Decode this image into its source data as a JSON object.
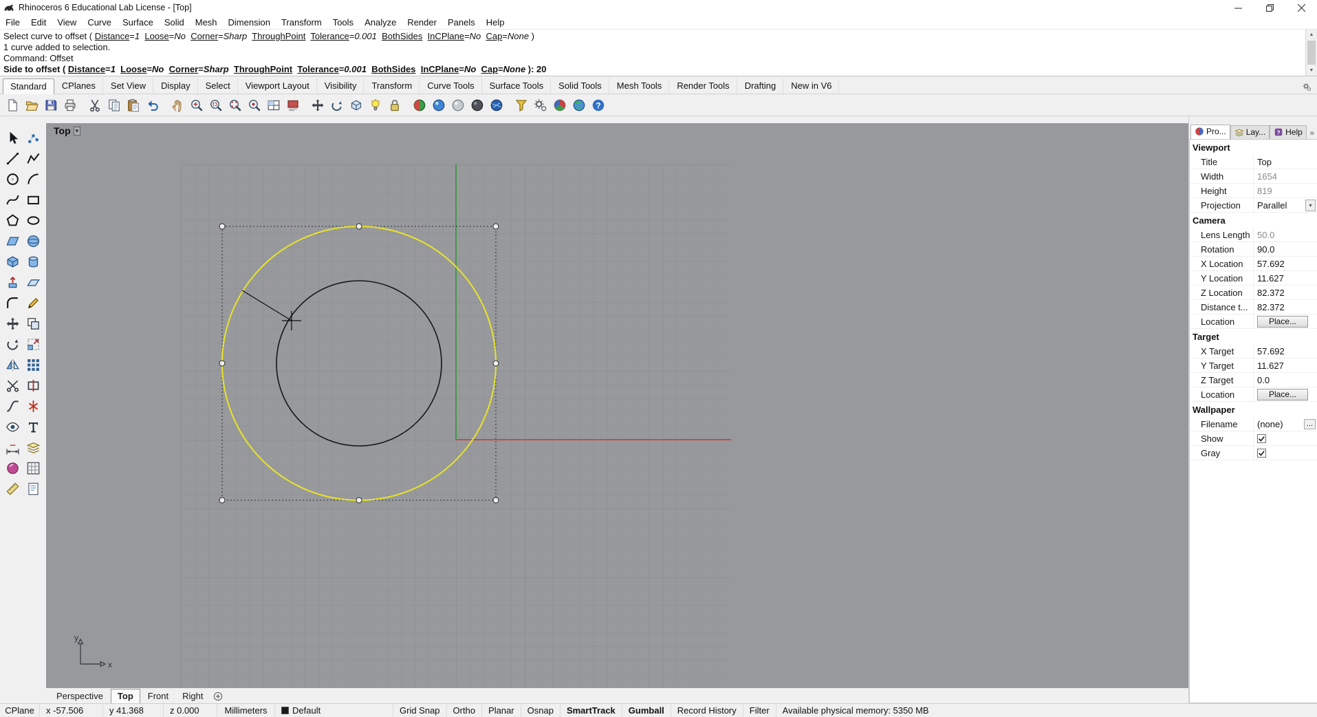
{
  "window": {
    "title": "Rhinoceros 6 Educational Lab License - [Top]"
  },
  "menubar": {
    "items": [
      "File",
      "Edit",
      "View",
      "Curve",
      "Surface",
      "Solid",
      "Mesh",
      "Dimension",
      "Transform",
      "Tools",
      "Analyze",
      "Render",
      "Panels",
      "Help"
    ]
  },
  "command_area": {
    "lines": [
      {
        "bold": false,
        "name": "command-history-line",
        "segments": [
          {
            "t": "Select curve to offset ( "
          },
          {
            "t": "Distance",
            "u": true
          },
          {
            "t": "="
          },
          {
            "t": "1",
            "i": true
          },
          {
            "t": "  "
          },
          {
            "t": "Loose",
            "u": true
          },
          {
            "t": "="
          },
          {
            "t": "No",
            "i": true
          },
          {
            "t": "  "
          },
          {
            "t": "Corner",
            "u": true
          },
          {
            "t": "="
          },
          {
            "t": "Sharp",
            "i": true
          },
          {
            "t": "  "
          },
          {
            "t": "ThroughPoint",
            "u": true
          },
          {
            "t": "  "
          },
          {
            "t": "Tolerance",
            "u": true
          },
          {
            "t": "="
          },
          {
            "t": "0.001",
            "i": true
          },
          {
            "t": "  "
          },
          {
            "t": "BothSides",
            "u": true
          },
          {
            "t": "  "
          },
          {
            "t": "InCPlane",
            "u": true
          },
          {
            "t": "="
          },
          {
            "t": "No",
            "i": true
          },
          {
            "t": "  "
          },
          {
            "t": "Cap",
            "u": true
          },
          {
            "t": "="
          },
          {
            "t": "None",
            "i": true
          },
          {
            "t": " )"
          }
        ]
      },
      {
        "bold": false,
        "name": "command-history-line",
        "segments": [
          {
            "t": "1 curve added to selection."
          }
        ]
      },
      {
        "bold": false,
        "name": "command-history-line",
        "segments": [
          {
            "t": "Command: Offset"
          }
        ]
      },
      {
        "bold": true,
        "name": "command-prompt-line",
        "segments": [
          {
            "t": "Side to offset ( "
          },
          {
            "t": "Distance",
            "u": true
          },
          {
            "t": "="
          },
          {
            "t": "1",
            "i": true
          },
          {
            "t": "  "
          },
          {
            "t": "Loose",
            "u": true
          },
          {
            "t": "="
          },
          {
            "t": "No",
            "i": true
          },
          {
            "t": "  "
          },
          {
            "t": "Corner",
            "u": true
          },
          {
            "t": "="
          },
          {
            "t": "Sharp",
            "i": true
          },
          {
            "t": "  "
          },
          {
            "t": "ThroughPoint",
            "u": true
          },
          {
            "t": "  "
          },
          {
            "t": "Tolerance",
            "u": true
          },
          {
            "t": "="
          },
          {
            "t": "0.001",
            "i": true
          },
          {
            "t": "  "
          },
          {
            "t": "BothSides",
            "u": true
          },
          {
            "t": "  "
          },
          {
            "t": "InCPlane",
            "u": true
          },
          {
            "t": "="
          },
          {
            "t": "No",
            "i": true
          },
          {
            "t": "  "
          },
          {
            "t": "Cap",
            "u": true
          },
          {
            "t": "="
          },
          {
            "t": "None",
            "i": true
          },
          {
            "t": " ): 20"
          }
        ]
      }
    ]
  },
  "toolbar_tabs": {
    "items": [
      {
        "label": "Standard",
        "active": true
      },
      {
        "label": "CPlanes"
      },
      {
        "label": "Set View"
      },
      {
        "label": "Display"
      },
      {
        "label": "Select"
      },
      {
        "label": "Viewport Layout"
      },
      {
        "label": "Visibility"
      },
      {
        "label": "Transform"
      },
      {
        "label": "Curve Tools"
      },
      {
        "label": "Surface Tools"
      },
      {
        "label": "Solid Tools"
      },
      {
        "label": "Mesh Tools"
      },
      {
        "label": "Render Tools"
      },
      {
        "label": "Drafting"
      },
      {
        "label": "New in V6"
      }
    ]
  },
  "toolbar": {
    "icons": [
      "new-file",
      "open-file",
      "save",
      "print",
      "cut",
      "copy",
      "paste",
      "undo",
      "pan",
      "zoom-dynamic",
      "zoom-window",
      "zoom-extents",
      "zoom-selected",
      "viewport-layout",
      "named-view",
      "move",
      "rotate-view",
      "set-view",
      "light",
      "lock",
      "shaded-mode",
      "rendered-mode",
      "ghosted-mode",
      "xray-mode",
      "raytraced-mode",
      "snap-filter",
      "options",
      "color-wheel",
      "earth",
      "help"
    ]
  },
  "sidebar": {
    "tools": [
      "select",
      "control-points",
      "line",
      "polyline",
      "circle",
      "arc",
      "curve",
      "rectangle",
      "polygon",
      "ellipse",
      "surface",
      "sphere",
      "box",
      "cylinder",
      "extrude",
      "plane",
      "fillet",
      "pencil",
      "move",
      "copy-tool",
      "rotate-tool",
      "scale-tool",
      "mirror-tool",
      "array-tool",
      "trim",
      "split",
      "join",
      "explode",
      "hide",
      "text",
      "dimension",
      "layer-tool",
      "material",
      "grid-tool",
      "measure",
      "notes"
    ]
  },
  "viewport": {
    "title": "Top",
    "axis_labels": {
      "x": "x",
      "y": "y"
    },
    "colors": {
      "background": "#97999d",
      "grid_minor": "#8e9094",
      "grid_major": "#85878b",
      "x_axis": "#bf4f47",
      "y_axis": "#3f9b46",
      "selected_curve": "#e9e426",
      "curve": "#17171a"
    },
    "tabs": [
      {
        "label": "Perspective"
      },
      {
        "label": "Top",
        "active": true
      },
      {
        "label": "Front"
      },
      {
        "label": "Right"
      }
    ]
  },
  "right_panel": {
    "tabs": [
      {
        "label": "Pro...",
        "icon": "properties-icon",
        "active": true
      },
      {
        "label": "Lay...",
        "icon": "layers-icon"
      },
      {
        "label": "Help",
        "icon": "help-icon"
      }
    ],
    "sections": [
      {
        "header": "Viewport",
        "rows": [
          {
            "label": "Title",
            "type": "text",
            "value": "Top"
          },
          {
            "label": "Width",
            "type": "readonly",
            "value": "1654"
          },
          {
            "label": "Height",
            "type": "readonly",
            "value": "819"
          },
          {
            "label": "Projection",
            "type": "dropdown",
            "value": "Parallel"
          }
        ]
      },
      {
        "header": "Camera",
        "rows": [
          {
            "label": "Lens Length",
            "type": "readonly",
            "value": "50.0"
          },
          {
            "label": "Rotation",
            "type": "text",
            "value": "90.0"
          },
          {
            "label": "X Location",
            "type": "text",
            "value": "57.692"
          },
          {
            "label": "Y Location",
            "type": "text",
            "value": "11.627"
          },
          {
            "label": "Z Location",
            "type": "text",
            "value": "82.372"
          },
          {
            "label": "Distance t...",
            "type": "text",
            "value": "82.372"
          },
          {
            "label": "Location",
            "type": "button",
            "value": "Place..."
          }
        ]
      },
      {
        "header": "Target",
        "rows": [
          {
            "label": "X Target",
            "type": "text",
            "value": "57.692"
          },
          {
            "label": "Y Target",
            "type": "text",
            "value": "11.627"
          },
          {
            "label": "Z Target",
            "type": "text",
            "value": "0.0"
          },
          {
            "label": "Location",
            "type": "button",
            "value": "Place..."
          }
        ]
      },
      {
        "header": "Wallpaper",
        "rows": [
          {
            "label": "Filename",
            "type": "filename",
            "value": "(none)",
            "button": "..."
          },
          {
            "label": "Show",
            "type": "checkbox",
            "checked": true
          },
          {
            "label": "Gray",
            "type": "checkbox",
            "checked": true
          }
        ]
      }
    ]
  },
  "statusbar": {
    "items": [
      {
        "label": "CPlane",
        "kind": "menu"
      },
      {
        "label": "x -57.506",
        "kind": "readout"
      },
      {
        "label": "y 41.368",
        "kind": "readout"
      },
      {
        "label": "z 0.000",
        "kind": "readout"
      },
      {
        "label": "Millimeters",
        "kind": "menu"
      },
      {
        "label": "Default",
        "kind": "menu",
        "swatch": "#1a1a1a"
      },
      {
        "label": "Grid Snap",
        "kind": "toggle"
      },
      {
        "label": "Ortho",
        "kind": "toggle"
      },
      {
        "label": "Planar",
        "kind": "toggle"
      },
      {
        "label": "Osnap",
        "kind": "toggle"
      },
      {
        "label": "SmartTrack",
        "kind": "toggle",
        "bold": true
      },
      {
        "label": "Gumball",
        "kind": "toggle",
        "bold": true
      },
      {
        "label": "Record History",
        "kind": "toggle"
      },
      {
        "label": "Filter",
        "kind": "toggle"
      },
      {
        "label": "Available physical memory: 5350 MB",
        "kind": "info"
      }
    ]
  }
}
